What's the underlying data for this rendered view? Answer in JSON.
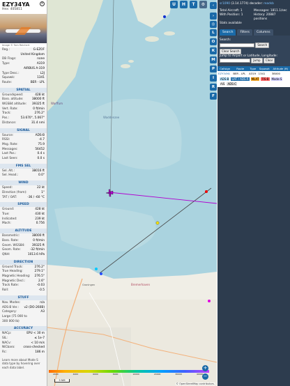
{
  "aircraft": {
    "callsign": "EZY34YA",
    "hex_label": "Hex:",
    "hex": "405811",
    "photo_caption": "Image © Tom Reichert",
    "close_symbol": "×"
  },
  "basic": [
    {
      "k": "Reg.:",
      "v": "G-EZOF"
    },
    {
      "k": "",
      "v": "United Kingdom"
    },
    {
      "k": "DB Flags:",
      "v": "none"
    },
    {
      "k": "Type:",
      "v": "A319"
    },
    {
      "k": "",
      "v": "AIRBUS A-319"
    },
    {
      "k": "Type Desc.:",
      "v": "L2J"
    },
    {
      "k": "Squawk:",
      "v": "1341"
    },
    {
      "k": "Route:",
      "v": "BER - LPL"
    }
  ],
  "sections": [
    {
      "title": "SPATIAL",
      "rows": [
        {
          "k": "Groundspeed:",
          "v": "428 kt"
        },
        {
          "k": "Baro. altitude:",
          "v": "38000 ft"
        },
        {
          "k": "WGS84 altitude:",
          "v": "39325 ft"
        },
        {
          "k": "Vert. Rate:",
          "v": "0 ft/min"
        },
        {
          "k": "Track:",
          "v": "276.2°"
        },
        {
          "k": "Pos.:",
          "v": "53.670°, 5.067°"
        },
        {
          "k": "Distance:",
          "v": "31.4 nmi"
        }
      ]
    },
    {
      "title": "SIGNAL",
      "rows": [
        {
          "k": "Source:",
          "v": "ADS-B"
        },
        {
          "k": "RSSI:",
          "v": "-4.7"
        },
        {
          "k": "Msg. Rate:",
          "v": "75.9"
        },
        {
          "k": "Messages:",
          "v": "56452"
        },
        {
          "k": "Last Pos.:",
          "v": "0.4 s"
        },
        {
          "k": "Last Seen:",
          "v": "0.0 s"
        }
      ]
    },
    {
      "title": "FMS SEL",
      "rows": [
        {
          "k": "Sel. Alt.:",
          "v": "38016 ft"
        },
        {
          "k": "Sel. Head.:",
          "v": "0.0°"
        }
      ]
    },
    {
      "title": "WIND",
      "rows": [
        {
          "k": "Speed:",
          "v": "22 kt"
        },
        {
          "k": "Direction (from):",
          "v": "1°"
        },
        {
          "k": "TAT / OAT:",
          "v": "-36 / -60 °C"
        }
      ]
    },
    {
      "title": "SPEED",
      "rows": [
        {
          "k": "Ground:",
          "v": "428 kt"
        },
        {
          "k": "True:",
          "v": "430 kt"
        },
        {
          "k": "Indicated:",
          "v": "239 kt"
        },
        {
          "k": "Mach:",
          "v": "0.756"
        }
      ]
    },
    {
      "title": "ALTITUDE",
      "rows": [
        {
          "k": "Barometric:",
          "v": "38000 ft"
        },
        {
          "k": "Baro. Rate:",
          "v": "0 ft/min"
        },
        {
          "k": "Geom. WGS84:",
          "v": "39325 ft"
        },
        {
          "k": "Geom. Rate:",
          "v": "-32 ft/min"
        },
        {
          "k": "QNH:",
          "v": "1013.6 hPa"
        }
      ]
    },
    {
      "title": "DIRECTION",
      "rows": [
        {
          "k": "Ground Track:",
          "v": "276.2°"
        },
        {
          "k": "True Heading:",
          "v": "279.1°"
        },
        {
          "k": "Magnetic Heading:",
          "v": "276.5°"
        },
        {
          "k": "Magnetic Decl.:",
          "v": "2.6°"
        },
        {
          "k": "Track Rate:",
          "v": "-0.03"
        },
        {
          "k": "Roll:",
          "v": "-0.5"
        }
      ]
    },
    {
      "title": "STUFF",
      "rows": [
        {
          "k": "Nav. Modes:",
          "v": "n/a"
        },
        {
          "k": "ADS-B Ver.:",
          "v": "v2 (DO-260B)"
        },
        {
          "k": "Category:",
          "v": "A3"
        },
        {
          "k": "Large (75 000 to",
          "v": ""
        },
        {
          "k": "300 000 lb)",
          "v": ""
        }
      ]
    },
    {
      "title": "ACCURACY",
      "rows": [
        {
          "k": "NACp:",
          "v": "EPU < 30 m"
        },
        {
          "k": "SIL:",
          "v": "≤ 1e-7"
        },
        {
          "k": "NACv:",
          "v": "< 10 m/s"
        },
        {
          "k": "NICbaro:",
          "v": "cross-checked"
        },
        {
          "k": "Rc:",
          "v": "186 m"
        }
      ]
    }
  ],
  "learn_more": "Learn more about Mode S data type by hovering over each data label.",
  "map": {
    "top_buttons": [
      "U",
      "H",
      "T"
    ],
    "toolbar_buttons": [
      "L",
      "O",
      "K",
      "M",
      "P",
      "I",
      "R",
      "F"
    ],
    "colorbar_ticks": [
      "2000",
      "4000",
      "6000",
      "8000",
      "10000",
      "20000",
      "30000",
      "40000+"
    ],
    "scale": "5 NM",
    "attribution": "© OpenStreetMap contributors.",
    "zoom_in": "+",
    "zoom_out": "−",
    "place_labels": {
      "town1": "Warffum",
      "region": "Groningen",
      "region2": "Bremerhaven",
      "sea": "Waddenzee"
    }
  },
  "right": {
    "header_link": "sr1090",
    "version": "(3.14.1774)",
    "decoder": "decoder:",
    "decoder_link": "readsb",
    "total_label": "Total Aircraft:",
    "total": "1",
    "messages_label": "Messages:",
    "messages": "1811.1/sec",
    "withpos_label": "With Position:",
    "withpos": "1",
    "history_label": "History:",
    "history": "20887 positions",
    "stats_label": "Stats available",
    "tabs": [
      "Search",
      "Filters",
      "Columns"
    ],
    "search_label": "Search:",
    "search_button": "Search",
    "clear_search": "Clear Search",
    "jump_label": "Jump to Airport or Latitude, Longitude:",
    "jump_button": "Jump",
    "clear_button": "Clear",
    "columns": [
      "Callsign",
      "Route",
      "Type",
      "Squawk",
      "Altitude (ft)"
    ],
    "row": [
      "EZY34YA",
      "BER - LPL",
      "A319",
      "1341",
      "38000"
    ],
    "legend": [
      "ADS-B",
      "UAT / ADS-R",
      "MLAT",
      "TIS-B",
      "Mode-S",
      "AIS",
      "ADS-C"
    ]
  },
  "colors": {
    "accent": "#1a6aa8",
    "panel_dark": "#2d3c4e",
    "track": "#b000d0",
    "route_line": "#444444"
  }
}
